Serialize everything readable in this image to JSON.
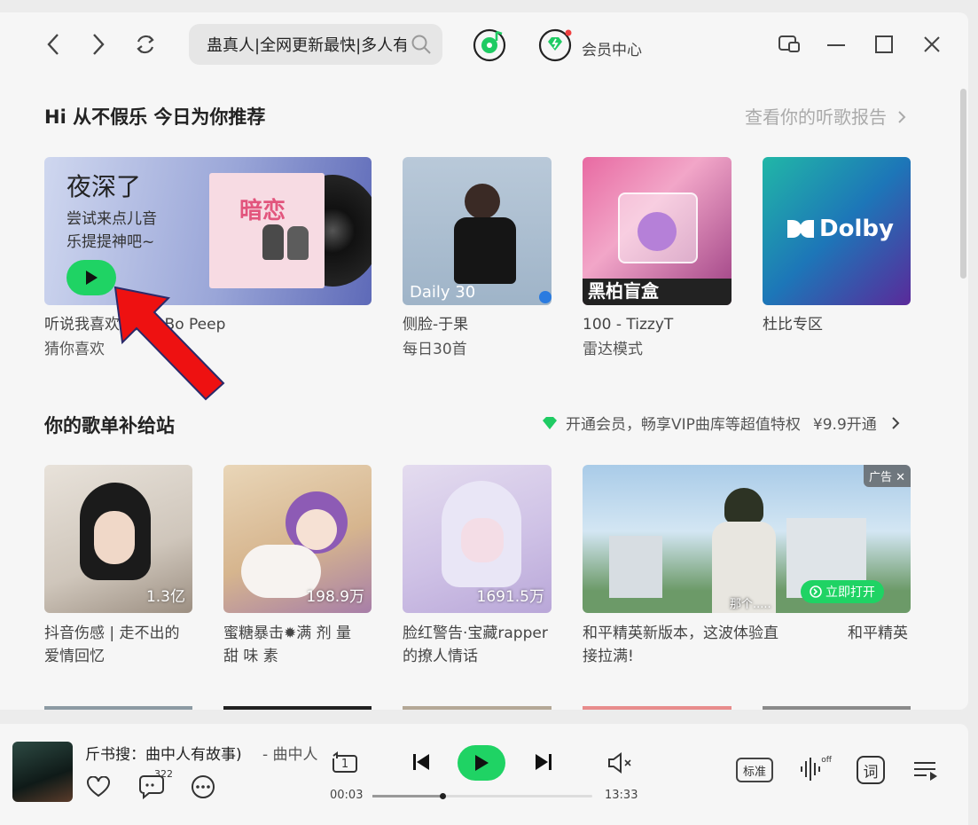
{
  "search": {
    "query": "蛊真人|全网更新最快|多人有"
  },
  "header": {
    "vip_center_label": "会员中心"
  },
  "recommend": {
    "title": "Hi 从不假乐 今日为你推荐",
    "report_link": "查看你的听歌报告",
    "banner": {
      "headline": "夜深了",
      "subline1": "尝试来点儿音",
      "subline2": "乐提提神吧~",
      "album_title": "暗恋"
    },
    "items": [
      {
        "title": "听说我喜欢番茄 / Bo Peep",
        "subtitle": "猜你喜欢"
      },
      {
        "title": "侧脸-于果",
        "subtitle": "每日30首",
        "tag": "Daily 30"
      },
      {
        "title": "100 - TizzyT",
        "subtitle": "雷达模式",
        "cover_text": "黑柏盲盒"
      },
      {
        "title": "杜比专区",
        "subtitle": "",
        "cover_text": "Dolby"
      }
    ]
  },
  "playlist_section": {
    "title": "你的歌单补给站",
    "vip_promo": "开通会员，畅享VIP曲库等超值特权",
    "vip_price": "¥9.9开通",
    "items": [
      {
        "line1": "抖音伤感 | 走不出的",
        "line2": "爱情回忆",
        "count": "1.3亿"
      },
      {
        "line1": "蜜糖暴击✹满 剂 量",
        "line2": "甜 味 素",
        "count": "198.9万"
      },
      {
        "line1": "脸红警告·宝藏rapper",
        "line2": "的撩人情话",
        "count": "1691.5万"
      }
    ],
    "ad": {
      "badge": "广告",
      "caption_line1": "和平精英新版本，这波体验直",
      "caption_line2": "接拉满!",
      "caption_right": "和平精英",
      "subtitle": "那个.....",
      "open_button": "立即打开"
    }
  },
  "player": {
    "song": "斤书搜：曲中人有故事)",
    "artist": "- 曲中人",
    "comment_count": "322",
    "loop_number": "1",
    "elapsed": "00:03",
    "duration": "13:33",
    "progress_fraction": 0.32,
    "quality_label": "标准",
    "effect_off": "off",
    "lyrics_label": "词"
  },
  "colors": {
    "accent_green": "#20d060",
    "arrow_red": "#ee1111"
  }
}
